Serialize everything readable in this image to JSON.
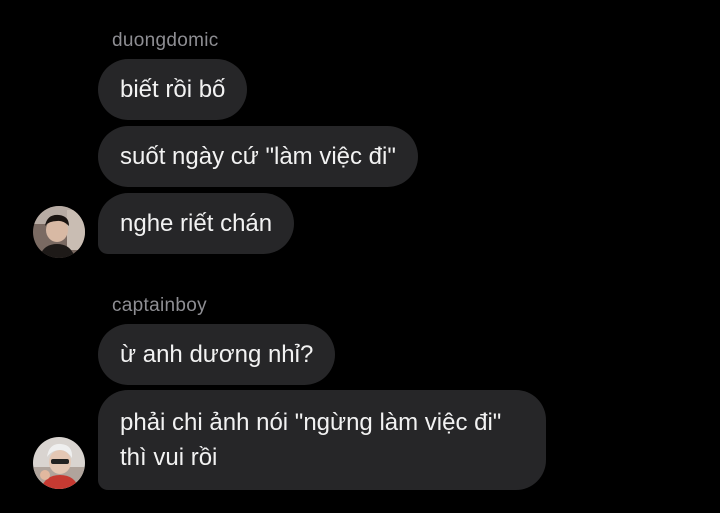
{
  "groups": [
    {
      "sender": "duongdomic",
      "messages": [
        "biết rồi bố",
        "suốt ngày cứ \"làm việc đi\"",
        "nghe riết chán"
      ],
      "avatar": "avatar-duongdomic"
    },
    {
      "sender": "captainboy",
      "messages": [
        "ừ anh dương nhỉ?",
        "phải chi ảnh nói \"ngừng làm việc đi\" thì vui rồi"
      ],
      "avatar": "avatar-captainboy"
    }
  ],
  "colors": {
    "background": "#000000",
    "bubble": "#262628",
    "text": "#f2f2f2",
    "sender": "#8e8e93"
  }
}
